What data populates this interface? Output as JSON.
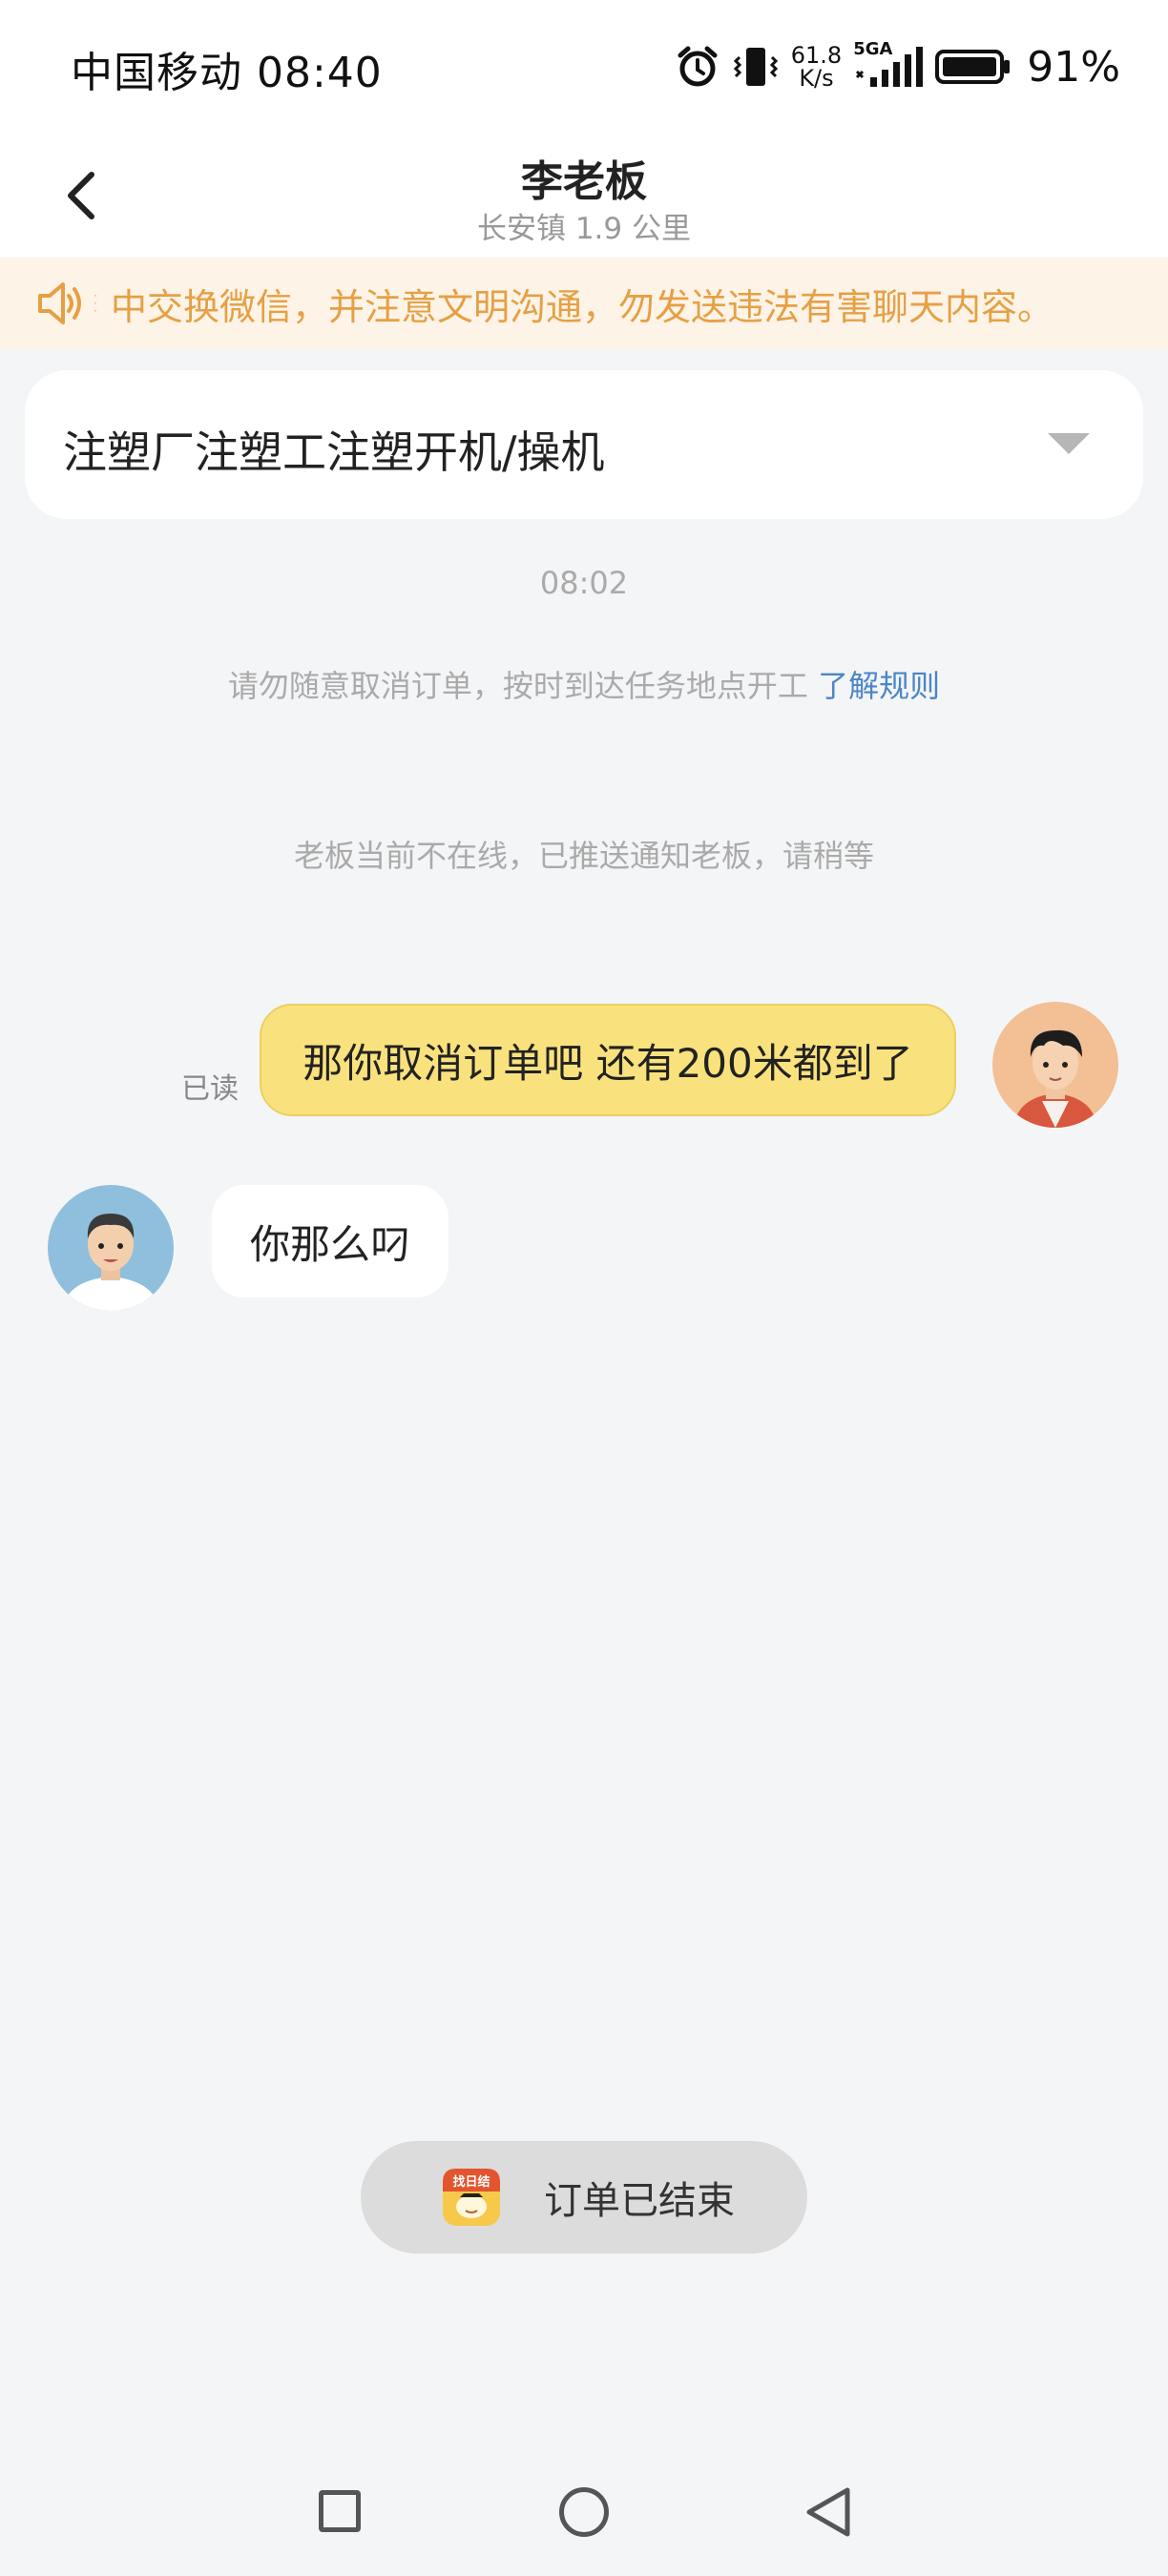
{
  "status_bar": {
    "carrier_time": "中国移动 08:40",
    "net_speed_value": "61.8",
    "net_speed_unit": "K/s",
    "network_type": "5GA",
    "battery": "91%"
  },
  "header": {
    "title": "李老板",
    "subtitle": "长安镇 1.9 公里"
  },
  "notice": {
    "text": "中交换微信，并注意文明沟通，勿发送违法有害聊天内容。",
    "color": "#e5a045"
  },
  "job_selector": {
    "value": "注塑厂注塑工注塑开机/操机"
  },
  "chat": {
    "time": "08:02",
    "rule_text": "请勿随意取消订单，按时到达任务地点开工",
    "rule_link": "了解规则",
    "offline_notice": "老板当前不在线，已推送通知老板，请稍等",
    "messages": [
      {
        "from": "me",
        "text": "那你取消订单吧  还有200米都到了",
        "status": "已读"
      },
      {
        "from": "boss",
        "text": "你那么叼"
      }
    ]
  },
  "order_status": {
    "text": "订单已结束",
    "logo_text": "找日结"
  },
  "colors": {
    "my_bubble": "#f9e27d",
    "link": "#4b86c6",
    "background": "#f4f5f7"
  }
}
